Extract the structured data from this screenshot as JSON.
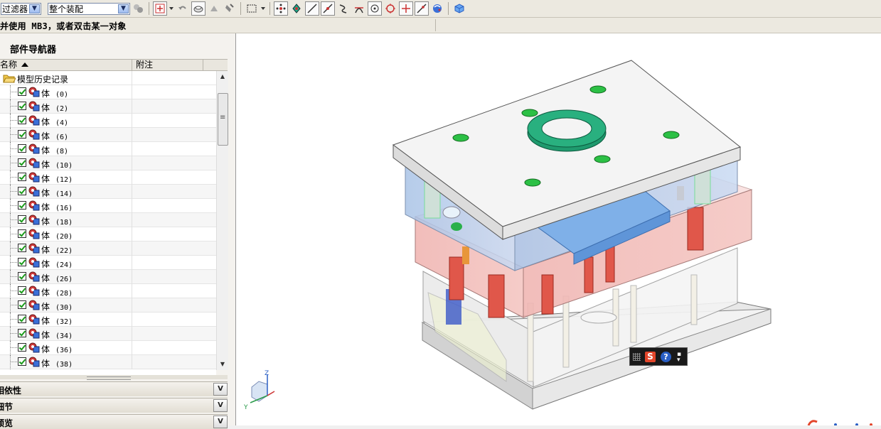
{
  "toolbar": {
    "filter_combo": "过滤器",
    "assembly_combo": "整个装配"
  },
  "status": {
    "message": "并使用 MB3，或者双击某一对象"
  },
  "navigator": {
    "title": "部件导航器",
    "col_name": "名称",
    "col_note": "附注",
    "root_label": "模型历史记录",
    "items": [
      {
        "label": "体",
        "num": "(0)"
      },
      {
        "label": "体",
        "num": "(2)"
      },
      {
        "label": "体",
        "num": "(4)"
      },
      {
        "label": "体",
        "num": "(6)"
      },
      {
        "label": "体",
        "num": "(8)"
      },
      {
        "label": "体",
        "num": "(10)"
      },
      {
        "label": "体",
        "num": "(12)"
      },
      {
        "label": "体",
        "num": "(14)"
      },
      {
        "label": "体",
        "num": "(16)"
      },
      {
        "label": "体",
        "num": "(18)"
      },
      {
        "label": "体",
        "num": "(20)"
      },
      {
        "label": "体",
        "num": "(22)"
      },
      {
        "label": "体",
        "num": "(24)"
      },
      {
        "label": "体",
        "num": "(26)"
      },
      {
        "label": "体",
        "num": "(28)"
      },
      {
        "label": "体",
        "num": "(30)"
      },
      {
        "label": "体",
        "num": "(32)"
      },
      {
        "label": "体",
        "num": "(34)"
      },
      {
        "label": "体",
        "num": "(36)"
      },
      {
        "label": "体",
        "num": "(38)"
      }
    ],
    "panels": [
      {
        "label": "相依性"
      },
      {
        "label": "细节"
      },
      {
        "label": "预览"
      }
    ]
  },
  "viewport": {
    "triad": {
      "z": "Z",
      "y": "Y"
    }
  },
  "ime": {
    "s": "S",
    "help": "?"
  },
  "colors": {
    "accent": "#2a5fc5",
    "check": "#1a9a1a",
    "plate_top": "#f4f4f4",
    "ring": "#1aa37a"
  }
}
